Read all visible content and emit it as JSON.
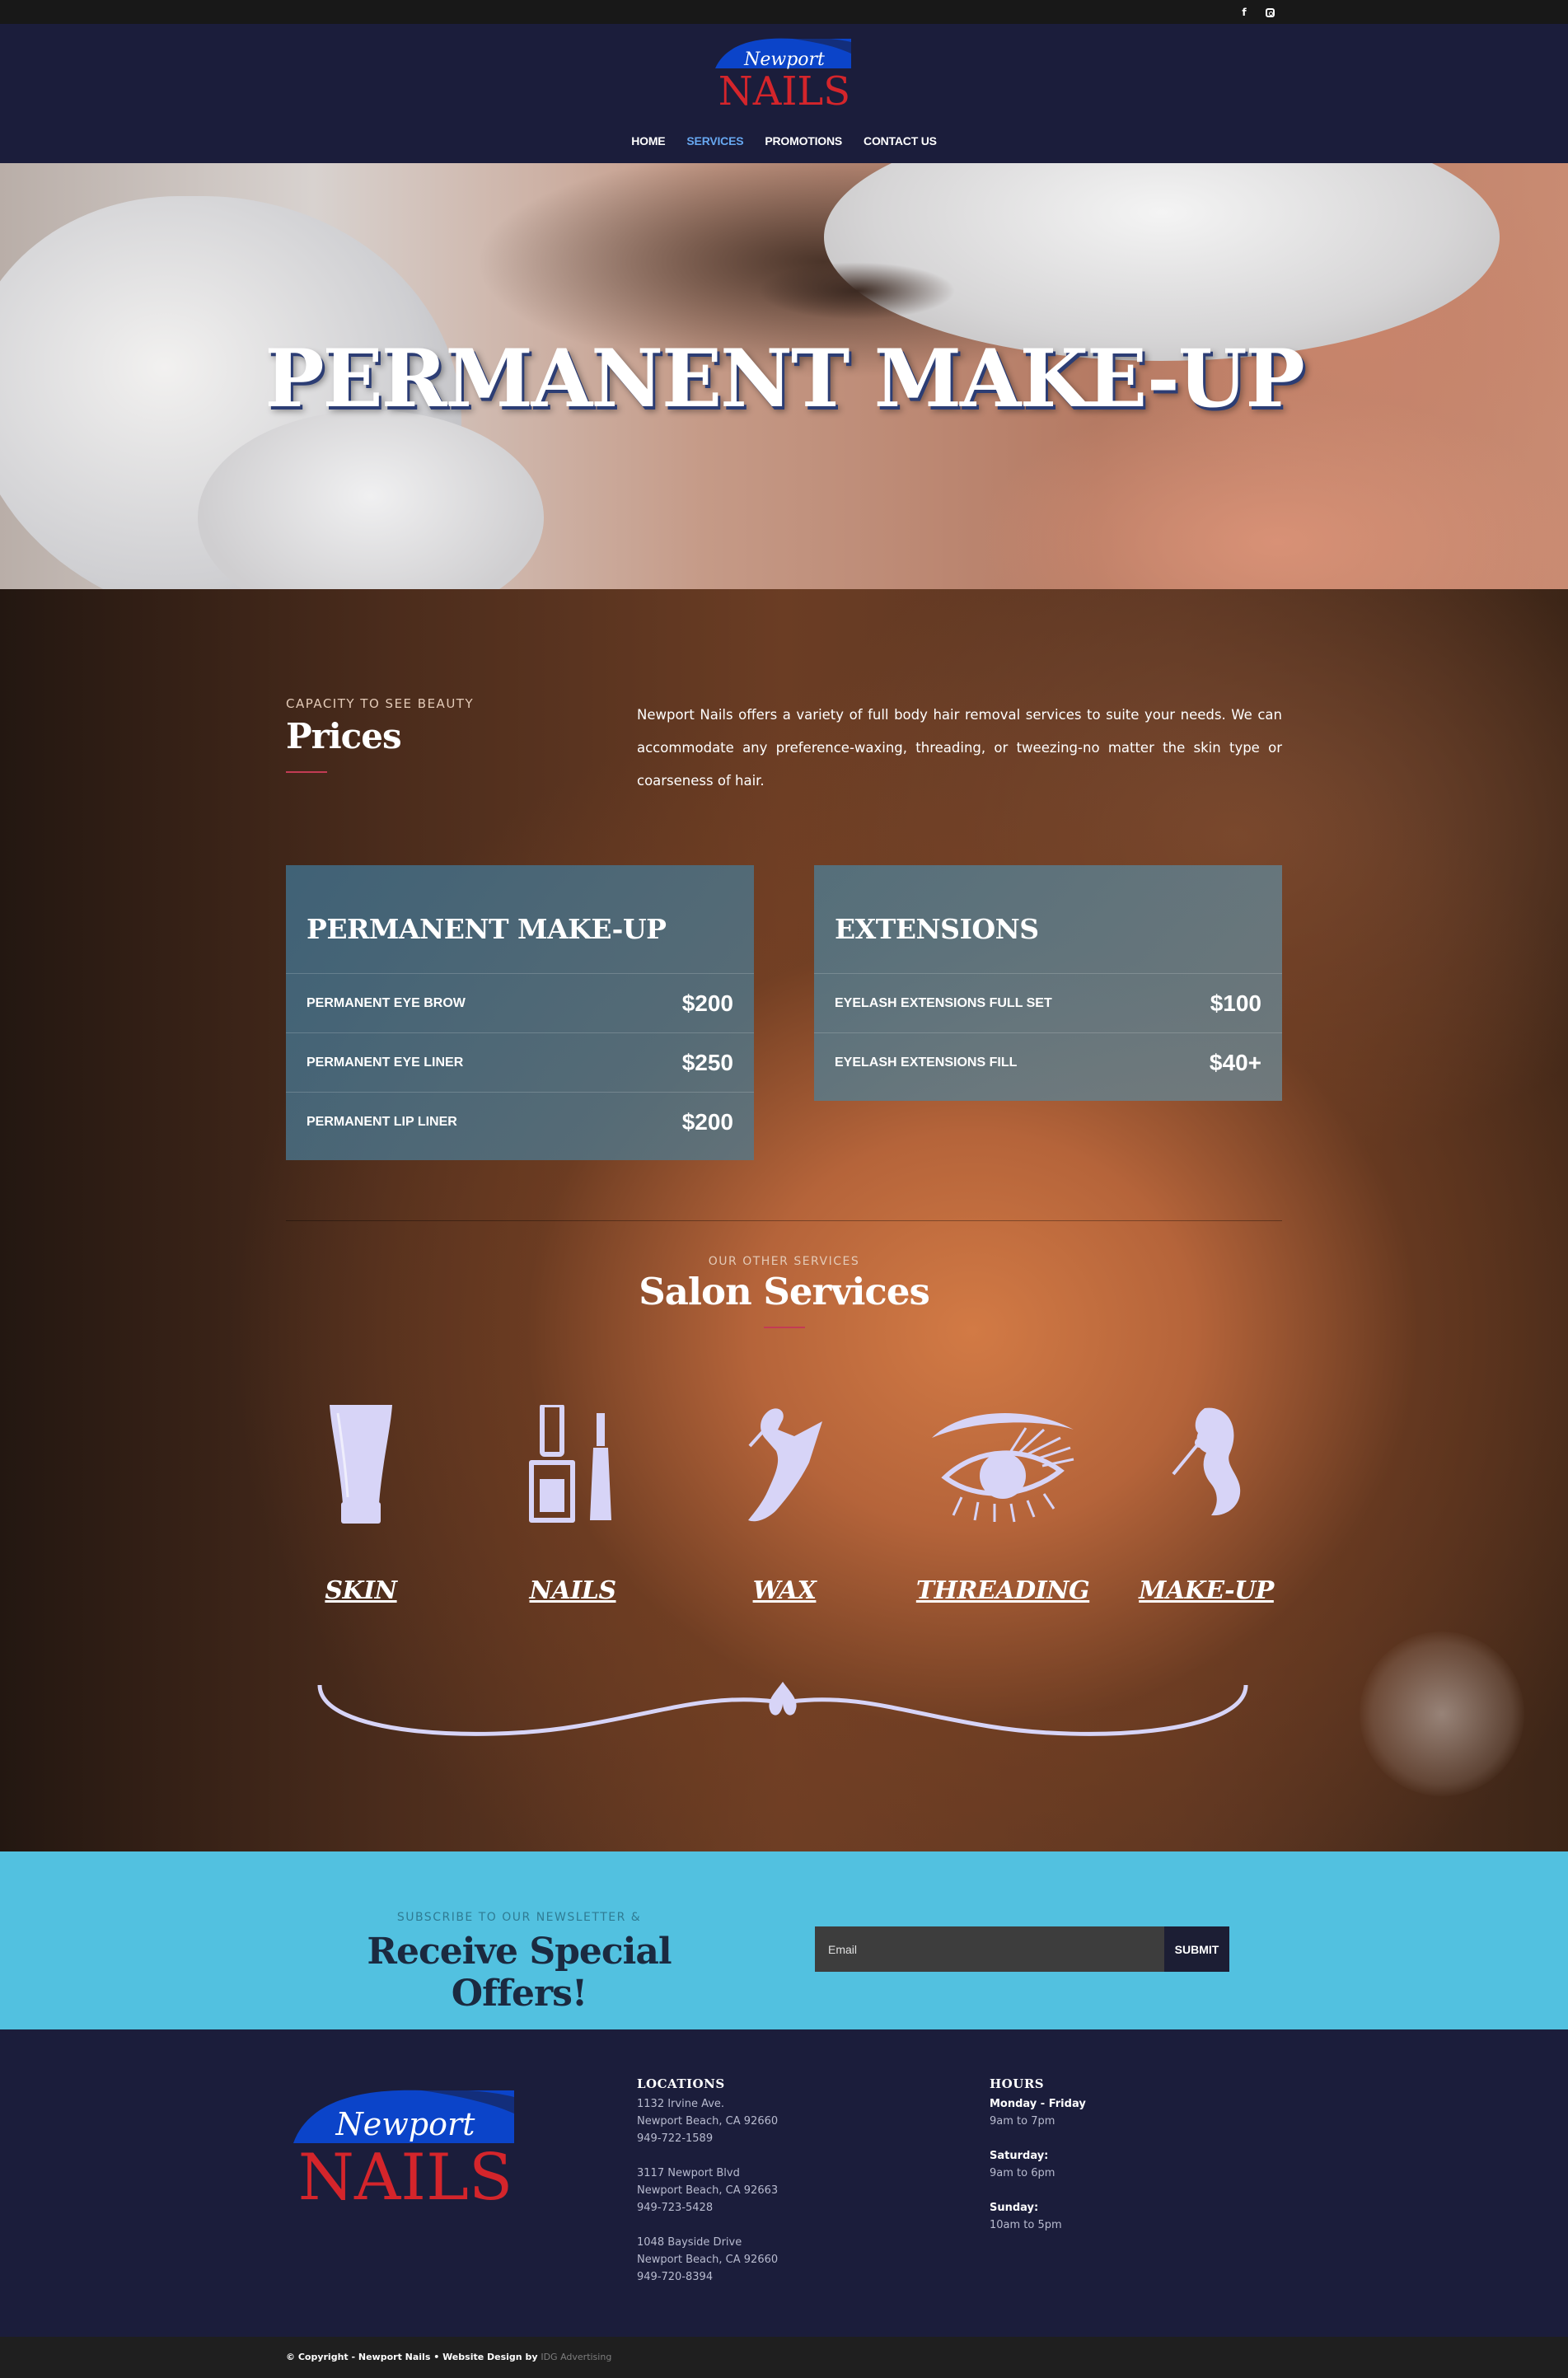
{
  "topbar": {
    "facebook": "f",
    "instagram": "instagram"
  },
  "brand": {
    "script": "Newport",
    "name": "NAILS",
    "blue": "#0b44c9",
    "red": "#d4252b"
  },
  "nav": [
    {
      "label": "HOME",
      "active": false
    },
    {
      "label": "SERVICES",
      "active": true
    },
    {
      "label": "PROMOTIONS",
      "active": false
    },
    {
      "label": "CONTACT US",
      "active": false
    }
  ],
  "hero": {
    "title": "PERMANENT MAKE-UP"
  },
  "prices": {
    "eyebrow": "CAPACITY TO SEE BEAUTY",
    "title": "Prices",
    "intro": "Newport Nails offers a variety of full body hair removal services to suite your needs. We can accommodate any preference-waxing, threading, or tweezing-no matter the skin type or coarseness of hair."
  },
  "cards": [
    {
      "title": "PERMANENT MAKE-UP",
      "rows": [
        {
          "item": "PERMANENT EYE BROW",
          "price": "$200"
        },
        {
          "item": "PERMANENT EYE LINER",
          "price": "$250"
        },
        {
          "item": "PERMANENT LIP LINER",
          "price": "$200"
        }
      ]
    },
    {
      "title": "EXTENSIONS",
      "rows": [
        {
          "item": "EYELASH EXTENSIONS FULL SET",
          "price": "$100"
        },
        {
          "item": "EYELASH EXTENSIONS FILL",
          "price": "$40+"
        }
      ]
    }
  ],
  "services": {
    "eyebrow": "OUR OTHER SERVICES",
    "title": "Salon Services",
    "items": [
      {
        "label": "SKIN",
        "icon": "lotion-tube-icon"
      },
      {
        "label": "NAILS",
        "icon": "nail-polish-icon"
      },
      {
        "label": "WAX",
        "icon": "leg-wax-icon"
      },
      {
        "label": "THREADING",
        "icon": "eye-brow-icon"
      },
      {
        "label": "MAKE-UP",
        "icon": "face-brush-icon"
      }
    ],
    "icon_color": "#d7d4f7"
  },
  "newsletter": {
    "eyebrow": "SUBSCRIBE TO OUR NEWSLETTER &",
    "title": "Receive Special Offers!",
    "placeholder": "Email",
    "submit": "SUBMIT"
  },
  "footer": {
    "locations_title": "LOCATIONS",
    "locations": [
      {
        "street": "1132 Irvine Ave.",
        "city": "Newport Beach, CA 92660",
        "phone": "949-722-1589"
      },
      {
        "street": "3117 Newport Blvd",
        "city": "Newport Beach, CA 92663",
        "phone": "949-723-5428"
      },
      {
        "street": "1048 Bayside Drive",
        "city": "Newport Beach, CA 92660",
        "phone": "949-720-8394"
      }
    ],
    "hours_title": "HOURS",
    "hours": [
      {
        "day": "Monday - Friday",
        "time": "9am to 7pm"
      },
      {
        "day": "Saturday:",
        "time": "9am to 6pm"
      },
      {
        "day": "Sunday:",
        "time": "10am to 5pm"
      }
    ],
    "copyright": "© Copyright - Newport Nails • Website Design by",
    "credit": "IDG Advertising"
  }
}
